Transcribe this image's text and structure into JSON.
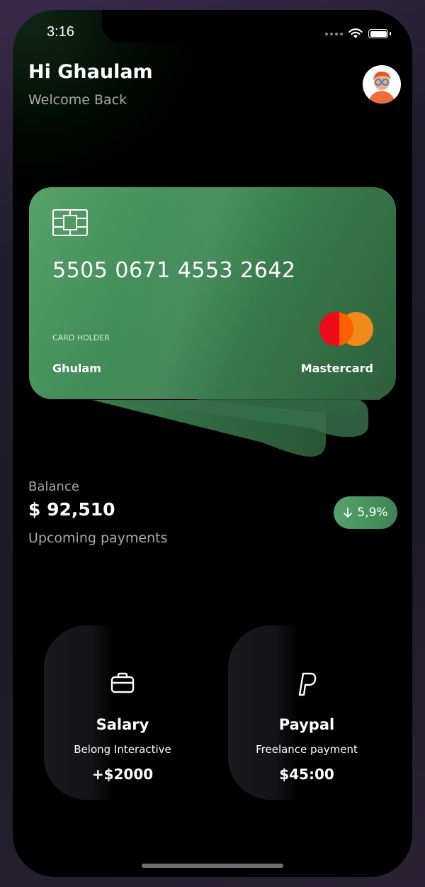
{
  "status_bar": {
    "time": "3:16"
  },
  "header": {
    "greeting": "Hi Ghaulam",
    "subtitle": "Welcome Back"
  },
  "card": {
    "number": "5505 0671 4553 2642",
    "holder_label": "CARD HOLDER",
    "holder_name": "Ghulam",
    "network": "Mastercard"
  },
  "balance": {
    "label": "Balance",
    "value": "$ 92,510",
    "change": "5,9%",
    "upcoming_label": "Upcoming payments"
  },
  "payments": [
    {
      "title": "Salary",
      "subtitle": "Belong Interactive",
      "amount": "+$2000",
      "icon": "briefcase-icon"
    },
    {
      "title": "Paypal",
      "subtitle": "Freelance payment",
      "amount": "$45:00",
      "icon": "paypal-icon"
    }
  ],
  "colors": {
    "accent_green": "#56a269",
    "card_green_dark": "#2e5f3a",
    "background": "#000000",
    "mastercard_red": "#f00a1b",
    "mastercard_orange": "#fb8c16"
  }
}
